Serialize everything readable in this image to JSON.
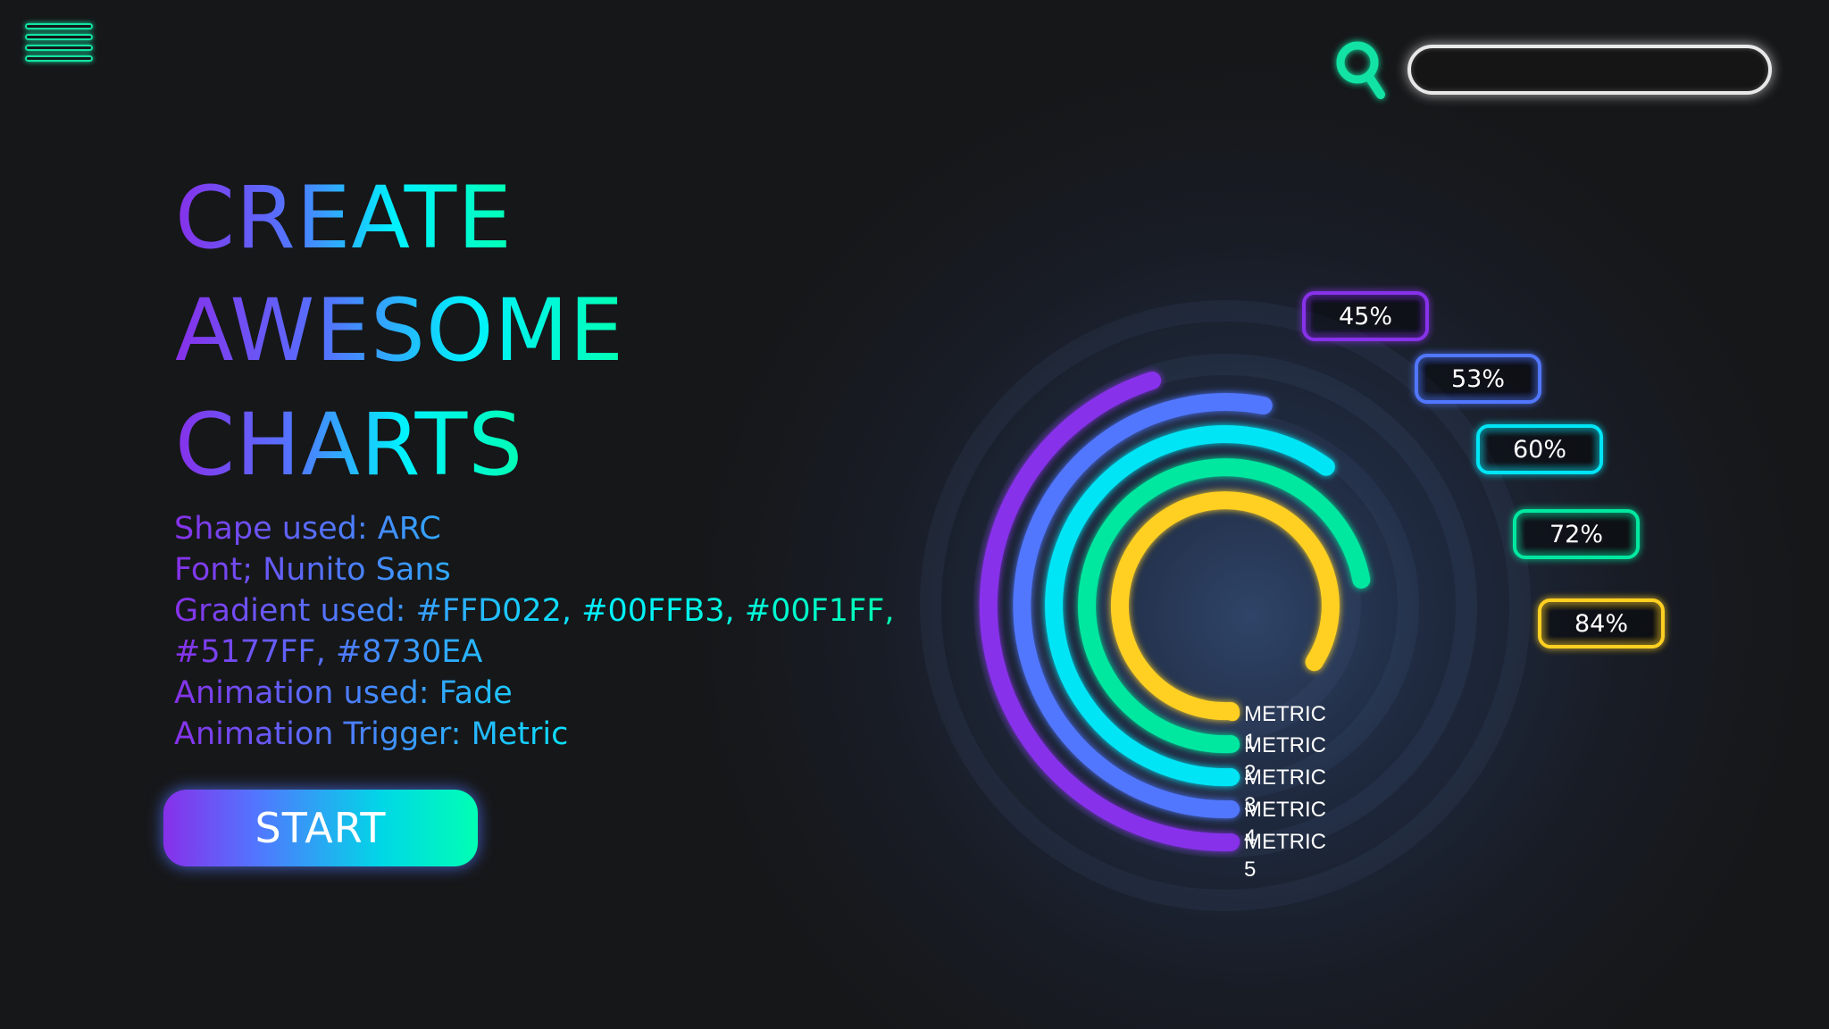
{
  "header": {
    "menu_icon": "hamburger-menu-icon",
    "search_icon": "search-icon",
    "search": {
      "value": "",
      "placeholder": ""
    }
  },
  "hero": {
    "lines": [
      "CREATE",
      "AWESOME",
      "CHARTS"
    ],
    "info": [
      "Shape used: ARC",
      "Font; Nunito Sans",
      "Gradient used: #FFD022, #00FFB3, #00F1FF,",
      "#5177FF, #8730EA",
      "Animation used: Fade",
      "Animation Trigger: Metric"
    ],
    "start_label": "START"
  },
  "colors": {
    "background": "#161719",
    "accent_green": "#12E3A4",
    "gradient": [
      "#FFD022",
      "#00FFB3",
      "#00F1FF",
      "#5177FF",
      "#8730EA"
    ]
  },
  "chart_data": {
    "type": "radial-bar",
    "series": [
      {
        "name": "METRIC 1",
        "value": 84,
        "color": "#FFD022",
        "label": "84%"
      },
      {
        "name": "METRIC 2",
        "value": 72,
        "color": "#00E8A0",
        "label": "72%"
      },
      {
        "name": "METRIC 3",
        "value": 60,
        "color": "#00E5F5",
        "label": "60%"
      },
      {
        "name": "METRIC 4",
        "value": 53,
        "color": "#5177FF",
        "label": "53%"
      },
      {
        "name": "METRIC 5",
        "value": 45,
        "color": "#8730EA",
        "label": "45%"
      }
    ],
    "max": 100
  }
}
